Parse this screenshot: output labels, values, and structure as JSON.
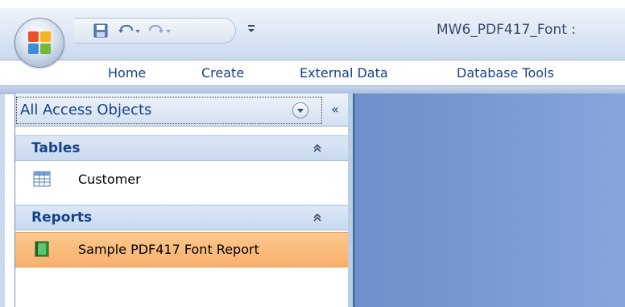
{
  "window": {
    "title": "MW6_PDF417_Font :"
  },
  "ribbon": {
    "tabs": [
      {
        "label": "Home"
      },
      {
        "label": "Create"
      },
      {
        "label": "External Data"
      },
      {
        "label": "Database Tools"
      }
    ]
  },
  "quick_access": {
    "icons": [
      "save-icon",
      "undo-icon",
      "redo-icon",
      "customize-icon"
    ]
  },
  "nav_pane": {
    "title": "All Access Objects",
    "collapse_glyph": "«",
    "groups": [
      {
        "label": "Tables",
        "items": [
          {
            "label": "Customer",
            "icon": "table-icon"
          }
        ]
      },
      {
        "label": "Reports",
        "items": [
          {
            "label": "Sample PDF417 Font Report",
            "icon": "report-icon",
            "selected": true
          }
        ]
      }
    ]
  },
  "colors": {
    "accent_text": "#15428b",
    "selected_item": "#f8b06a",
    "workspace": "#7b9cd4"
  }
}
